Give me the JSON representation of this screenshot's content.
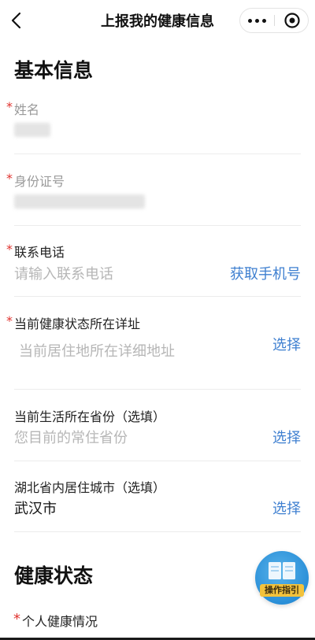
{
  "nav": {
    "title": "上报我的健康信息"
  },
  "basic_info": {
    "title": "基本信息",
    "name": {
      "label": "姓名"
    },
    "id_number": {
      "label": "身份证号"
    },
    "phone": {
      "label": "联系电话",
      "placeholder": "请输入联系电话",
      "action": "获取手机号"
    },
    "address": {
      "label": "当前健康状态所在详址",
      "placeholder": "当前居住地所在详细地址",
      "action": "选择"
    },
    "province": {
      "label": "当前生活所在省份（选填）",
      "placeholder": "您目前的常住省份",
      "action": "选择"
    },
    "city": {
      "label": "湖北省内居住城市（选填）",
      "value": "武汉市",
      "action": "选择"
    }
  },
  "health_status": {
    "title": "健康状态",
    "personal": {
      "label": "个人健康情况"
    }
  },
  "guide_button": {
    "label": "操作指引"
  },
  "required_mark": "*",
  "colors": {
    "accent": "#3e7fd0",
    "required": "#e0332f",
    "placeholder": "#b6b6b6",
    "guide_button": "#2a8fd8",
    "guide_tag": "#f2c23c"
  },
  "icons": {
    "back": "chevron-left-icon",
    "more": "more-dots-icon",
    "close": "target-circle-icon",
    "guide": "book-icon"
  }
}
